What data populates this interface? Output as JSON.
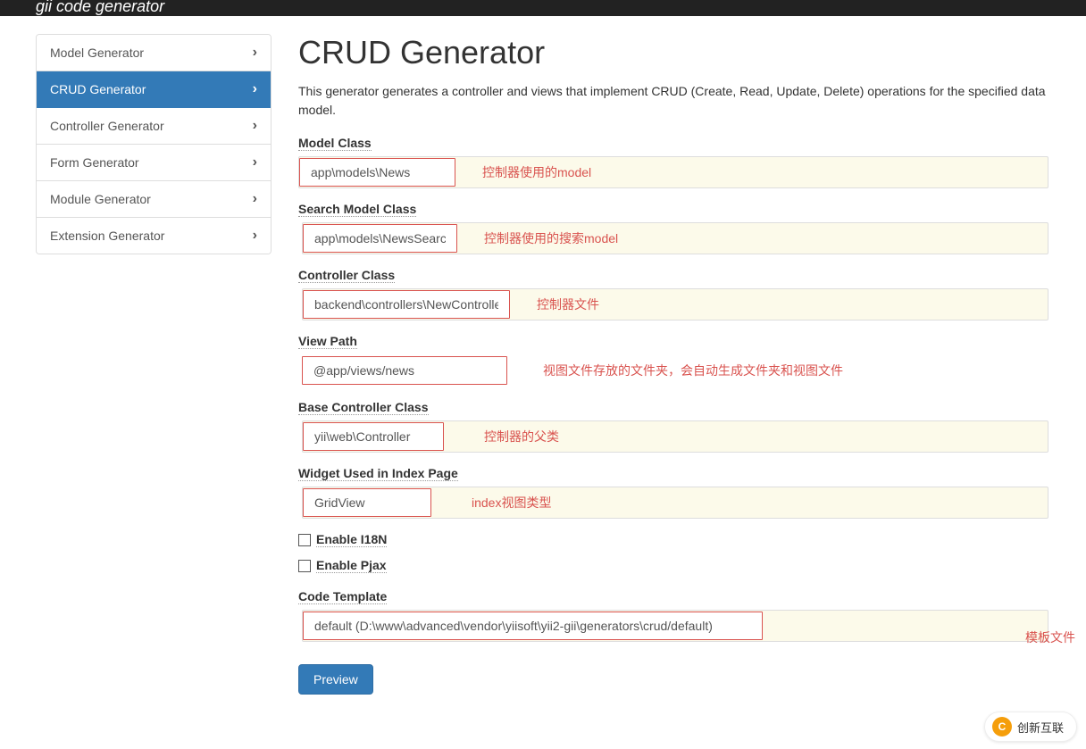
{
  "navbar": {
    "brand": "gii code generator"
  },
  "sidebar": {
    "items": [
      {
        "label": "Model Generator",
        "active": false
      },
      {
        "label": "CRUD Generator",
        "active": true
      },
      {
        "label": "Controller Generator",
        "active": false
      },
      {
        "label": "Form Generator",
        "active": false
      },
      {
        "label": "Module Generator",
        "active": false
      },
      {
        "label": "Extension Generator",
        "active": false
      }
    ]
  },
  "page": {
    "title": "CRUD Generator",
    "description": "This generator generates a controller and views that implement CRUD (Create, Read, Update, Delete) operations for the specified data model."
  },
  "form": {
    "modelClass": {
      "label": "Model Class",
      "value": "app\\models\\News",
      "annotation": "控制器使用的model"
    },
    "searchModelClass": {
      "label": "Search Model Class",
      "value": "app\\models\\NewsSearch",
      "annotation": "控制器使用的搜索model"
    },
    "controllerClass": {
      "label": "Controller Class",
      "value": "backend\\controllers\\NewController",
      "annotation": "控制器文件"
    },
    "viewPath": {
      "label": "View Path",
      "value": "@app/views/news",
      "annotation": "视图文件存放的文件夹，会自动生成文件夹和视图文件"
    },
    "baseControllerClass": {
      "label": "Base Controller Class",
      "value": "yii\\web\\Controller",
      "annotation": "控制器的父类"
    },
    "widgetIndex": {
      "label": "Widget Used in Index Page",
      "value": "GridView",
      "annotation": "index视图类型"
    },
    "enableI18N": {
      "label": "Enable I18N",
      "checked": false
    },
    "enablePjax": {
      "label": "Enable Pjax",
      "checked": false
    },
    "codeTemplate": {
      "label": "Code Template",
      "value": "default (D:\\www\\advanced\\vendor\\yiisoft\\yii2-gii\\generators\\crud/default)",
      "annotation": "模板文件"
    },
    "previewButton": "Preview"
  },
  "watermark": {
    "text": "创新互联"
  }
}
